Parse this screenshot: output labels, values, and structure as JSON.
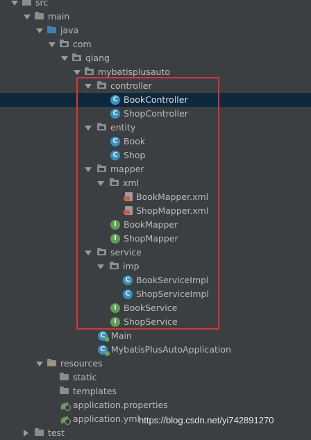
{
  "project_tree": {
    "nodes": [
      {
        "label": "src",
        "icon": "folder-icon",
        "expanded": true
      },
      {
        "label": "main",
        "icon": "folder-icon",
        "expanded": true
      },
      {
        "label": "java",
        "icon": "source-folder-icon",
        "expanded": true
      },
      {
        "label": "com",
        "icon": "package-icon",
        "expanded": true
      },
      {
        "label": "qiang",
        "icon": "package-icon",
        "expanded": true
      },
      {
        "label": "mybatisplusauto",
        "icon": "package-icon",
        "expanded": true
      },
      {
        "label": "controller",
        "icon": "package-icon",
        "expanded": true
      },
      {
        "label": "BookController",
        "icon": "class-icon",
        "selected": true
      },
      {
        "label": "ShopController",
        "icon": "class-icon"
      },
      {
        "label": "entity",
        "icon": "package-icon",
        "expanded": true
      },
      {
        "label": "Book",
        "icon": "class-icon"
      },
      {
        "label": "Shop",
        "icon": "class-icon"
      },
      {
        "label": "mapper",
        "icon": "package-icon",
        "expanded": true
      },
      {
        "label": "xml",
        "icon": "package-icon",
        "expanded": true
      },
      {
        "label": "BookMapper.xml",
        "icon": "xml-file-icon"
      },
      {
        "label": "ShopMapper.xml",
        "icon": "xml-file-icon"
      },
      {
        "label": "BookMapper",
        "icon": "interface-icon"
      },
      {
        "label": "ShopMapper",
        "icon": "interface-icon"
      },
      {
        "label": "service",
        "icon": "package-icon",
        "expanded": true
      },
      {
        "label": "imp",
        "icon": "package-icon",
        "expanded": true
      },
      {
        "label": "BookServiceImpl",
        "icon": "class-icon"
      },
      {
        "label": "ShopServiceImpl",
        "icon": "class-icon"
      },
      {
        "label": "BookService",
        "icon": "interface-icon"
      },
      {
        "label": "ShopService",
        "icon": "interface-icon"
      },
      {
        "label": "Main",
        "icon": "main-class-icon"
      },
      {
        "label": "MybatisPlusAutoApplication",
        "icon": "spring-boot-class-icon"
      },
      {
        "label": "resources",
        "icon": "resources-folder-icon",
        "expanded": true
      },
      {
        "label": "static",
        "icon": "folder-icon"
      },
      {
        "label": "templates",
        "icon": "folder-icon"
      },
      {
        "label": "application.properties",
        "icon": "properties-file-icon"
      },
      {
        "label": "application.yml",
        "icon": "yml-file-icon"
      },
      {
        "label": "test",
        "icon": "folder-icon",
        "expanded": false
      }
    ]
  },
  "icon_glyphs": {
    "class": "C",
    "interface": "I"
  },
  "colors": {
    "background": "#3c3f41",
    "selection": "#0d293e",
    "highlight_box": "#e03232",
    "class_icon": "#3592c4",
    "interface_icon": "#5fa052",
    "source_folder": "#3a82b5"
  },
  "watermark": "https://blog.csdn.net/yi742891270"
}
